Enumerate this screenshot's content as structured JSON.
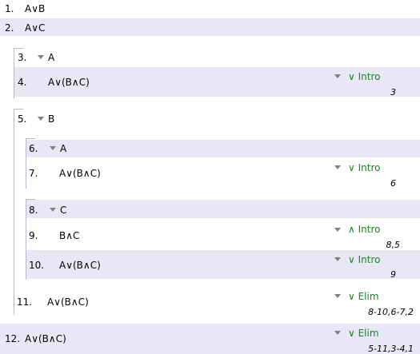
{
  "lines": [
    {
      "num": "1.",
      "formula": "A∨B"
    },
    {
      "num": "2.",
      "formula": "A∨C"
    },
    {
      "num": "3.",
      "formula": "A"
    },
    {
      "num": "4.",
      "formula": "A∨(B∧C)",
      "rule": "∨ Intro",
      "cite": "3"
    },
    {
      "num": "5.",
      "formula": "B"
    },
    {
      "num": "6.",
      "formula": "A"
    },
    {
      "num": "7.",
      "formula": "A∨(B∧C)",
      "rule": "∨ Intro",
      "cite": "6"
    },
    {
      "num": "8.",
      "formula": "C"
    },
    {
      "num": "9.",
      "formula": "B∧C",
      "rule": "∧ Intro",
      "cite": "8,5"
    },
    {
      "num": "10.",
      "formula": "A∨(B∧C)",
      "rule": "∨ Intro",
      "cite": "9"
    },
    {
      "num": "11.",
      "formula": "A∨(B∧C)",
      "rule": "∨ Elim",
      "cite": "8-10,6-7,2"
    },
    {
      "num": "12.",
      "formula": "A∨(B∧C)",
      "rule": "∨ Elim",
      "cite": "5-11,3-4,1"
    }
  ],
  "colors": {
    "band": "#e7e7f6",
    "rule_text": "#18861f",
    "bars": "#b8b8c8",
    "dropdown": "#808080"
  },
  "icons": {
    "assumption": "triangle-down-icon",
    "rule_dropdown": "triangle-down-icon"
  }
}
